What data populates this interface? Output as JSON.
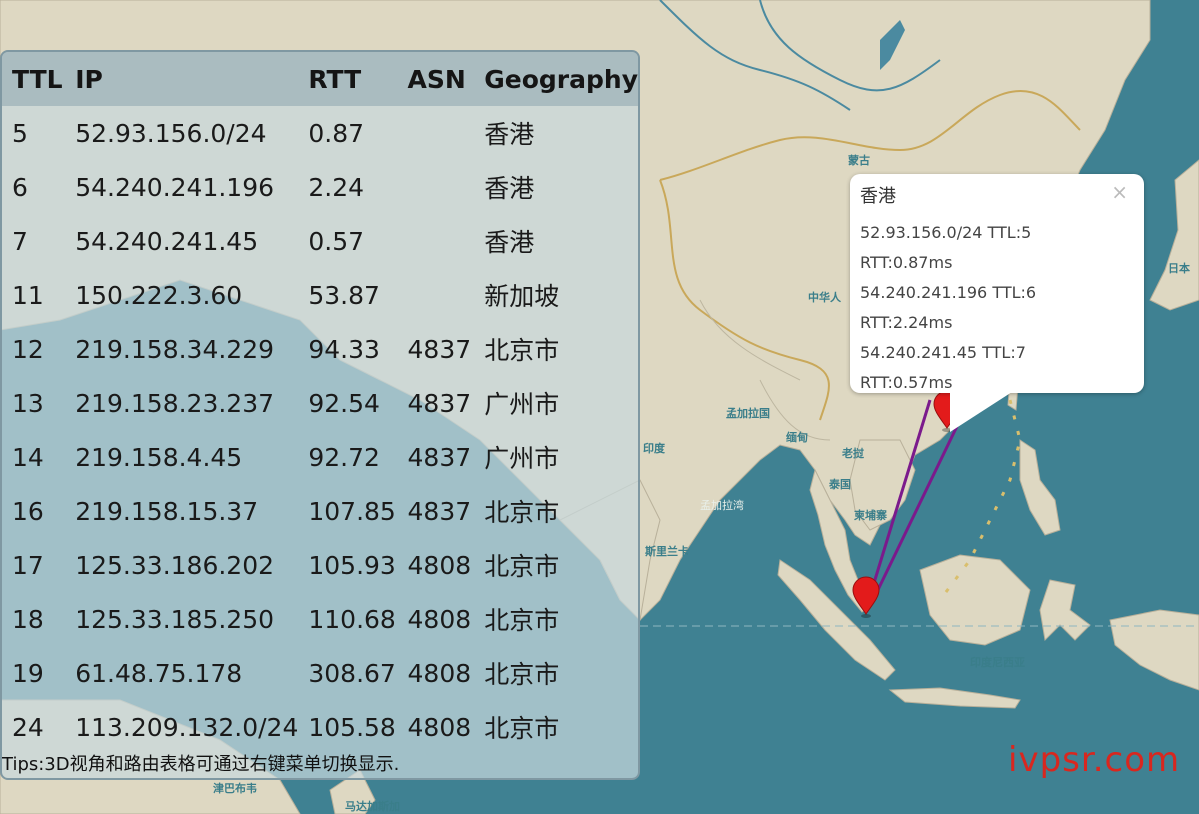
{
  "map_labels": {
    "mongolia": "蒙古",
    "china": "中华人",
    "bangladesh": "孟加拉国",
    "india": "印度",
    "myanmar": "缅甸",
    "laos": "老挝",
    "thailand": "泰国",
    "cambodia": "柬埔寨",
    "bay_of_bengal": "孟加拉湾",
    "sri_lanka": "斯里兰卡",
    "zimbabwe": "津巴布韦",
    "madagascar": "马达加斯加",
    "indonesia": "印度尼西亚",
    "japan": "日本"
  },
  "route_table": {
    "headers": [
      "TTL",
      "IP",
      "RTT",
      "ASN",
      "Geography"
    ],
    "rows": [
      {
        "ttl": "5",
        "ip": "52.93.156.0/24",
        "rtt": "0.87",
        "asn": "",
        "geo": "香港"
      },
      {
        "ttl": "6",
        "ip": "54.240.241.196",
        "rtt": "2.24",
        "asn": "",
        "geo": "香港"
      },
      {
        "ttl": "7",
        "ip": "54.240.241.45",
        "rtt": "0.57",
        "asn": "",
        "geo": "香港"
      },
      {
        "ttl": "11",
        "ip": "150.222.3.60",
        "rtt": "53.87",
        "asn": "",
        "geo": "新加坡"
      },
      {
        "ttl": "12",
        "ip": "219.158.34.229",
        "rtt": "94.33",
        "asn": "4837",
        "geo": "北京市"
      },
      {
        "ttl": "13",
        "ip": "219.158.23.237",
        "rtt": "92.54",
        "asn": "4837",
        "geo": "广州市"
      },
      {
        "ttl": "14",
        "ip": "219.158.4.45",
        "rtt": "92.72",
        "asn": "4837",
        "geo": "广州市"
      },
      {
        "ttl": "16",
        "ip": "219.158.15.37",
        "rtt": "107.85",
        "asn": "4837",
        "geo": "北京市"
      },
      {
        "ttl": "17",
        "ip": "125.33.186.202",
        "rtt": "105.93",
        "asn": "4808",
        "geo": "北京市"
      },
      {
        "ttl": "18",
        "ip": "125.33.185.250",
        "rtt": "110.68",
        "asn": "4808",
        "geo": "北京市"
      },
      {
        "ttl": "19",
        "ip": "61.48.75.178",
        "rtt": "308.67",
        "asn": "4808",
        "geo": "北京市"
      },
      {
        "ttl": "24",
        "ip": "113.209.132.0/24",
        "rtt": "105.58",
        "asn": "4808",
        "geo": "北京市"
      }
    ],
    "tips": "Tips:3D视角和路由表格可通过右键菜单切换显示."
  },
  "popup": {
    "title": "香港",
    "close_glyph": "×",
    "lines": [
      "52.93.156.0/24 TTL:5",
      "RTT:0.87ms",
      "54.240.241.196 TTL:6",
      "RTT:2.24ms",
      "54.240.241.45 TTL:7",
      "RTT:0.57ms"
    ]
  },
  "watermark": "ivpsr.com",
  "colors": {
    "ocean": "#3f8192",
    "land": "#ded8c2",
    "route_line": "#7b1a8c",
    "marker": "#e31b1b",
    "border": "#c9a85a"
  }
}
